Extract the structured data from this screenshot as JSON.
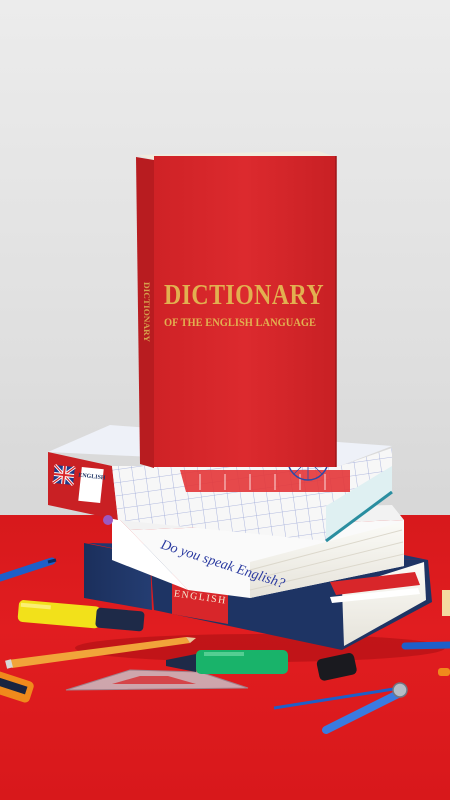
{
  "photo": {
    "red_book": {
      "title": "DICTIONARY",
      "subtitle": "OF THE ENGLISH LANGUAGE",
      "spine_title": "DICTIONARY",
      "color": "#d8262a",
      "lettering_color": "#e2b050"
    },
    "top_book": {
      "label": "ENGLISH",
      "handwriting": "Do you speak English?"
    },
    "bottom_book": {
      "spine_label": "ENGLISH"
    },
    "colors": {
      "wall": "#e4e4e4",
      "table": "#dc1c20",
      "navy": "#1f3565",
      "teal": "#2a8ea0"
    }
  }
}
